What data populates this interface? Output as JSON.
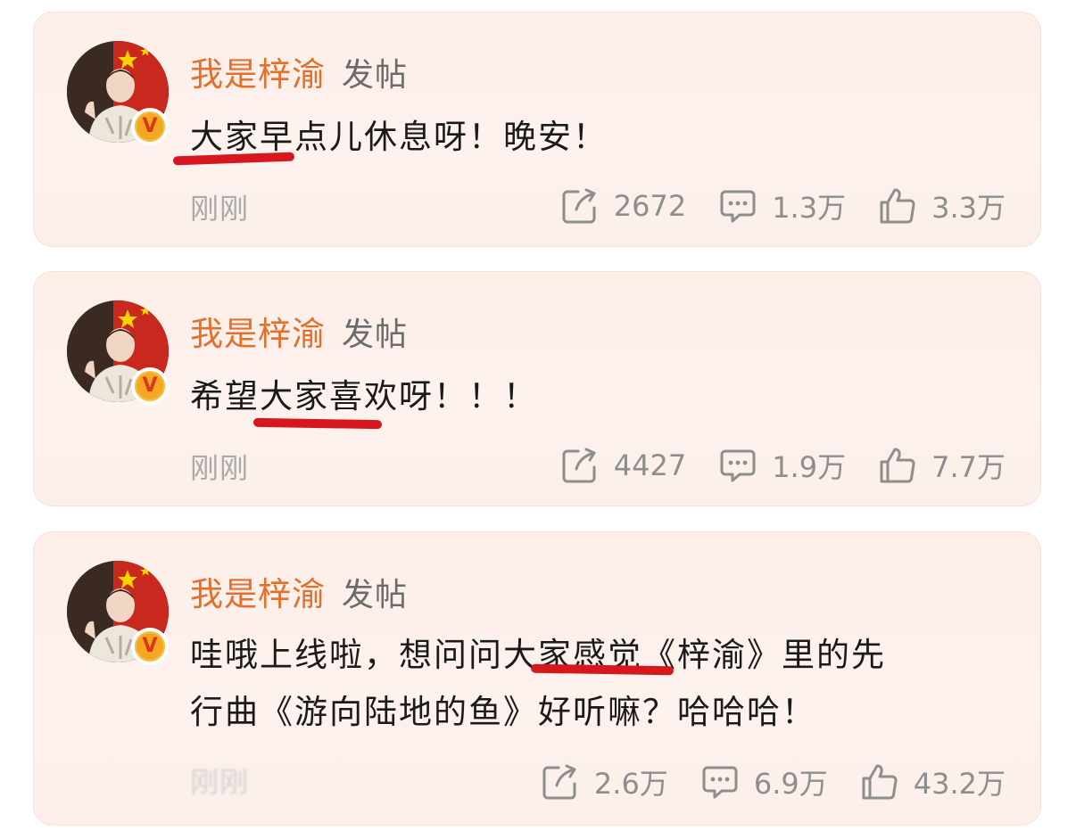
{
  "colors": {
    "username": "#e46f2b",
    "underline": "#d6171d",
    "card_bg": "#fdeee8",
    "stat_gray": "#8e8e8e"
  },
  "posts": [
    {
      "username": "我是梓渝",
      "action": "发帖",
      "text_lines": [
        "大家早点儿休息呀！晚安！"
      ],
      "timestamp": "刚刚",
      "verified_badge": "V",
      "stats": {
        "reposts": "2672",
        "comments": "1.3万",
        "likes": "3.3万"
      }
    },
    {
      "username": "我是梓渝",
      "action": "发帖",
      "text_lines": [
        "希望大家喜欢呀！！！"
      ],
      "timestamp": "刚刚",
      "verified_badge": "V",
      "stats": {
        "reposts": "4427",
        "comments": "1.9万",
        "likes": "7.7万"
      }
    },
    {
      "username": "我是梓渝",
      "action": "发帖",
      "text_lines": [
        "哇哦上线啦，想问问大家感觉《梓渝》里的先",
        "行曲《游向陆地的鱼》好听嘛？哈哈哈！"
      ],
      "timestamp": "刚刚",
      "verified_badge": "V",
      "stats": {
        "reposts": "2.6万",
        "comments": "6.9万",
        "likes": "43.2万"
      }
    }
  ],
  "icons": {
    "repost": "repost-icon",
    "comment": "comment-icon",
    "like": "thumbs-up-icon",
    "verified": "verified-v-icon"
  }
}
